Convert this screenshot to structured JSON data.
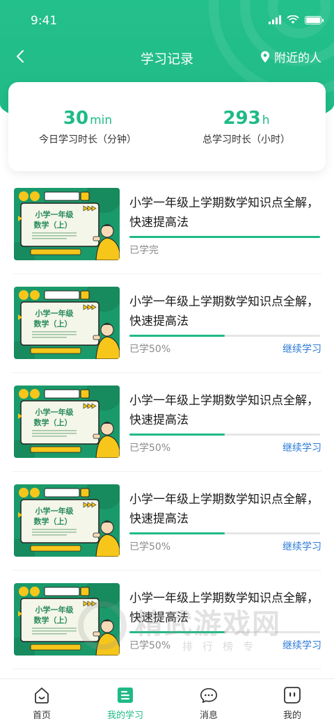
{
  "status_bar": {
    "time": "9:41"
  },
  "nav": {
    "title": "学习记录",
    "nearby_label": "附近的人"
  },
  "stats": {
    "today": {
      "value": "30",
      "unit": "min",
      "label": "今日学习时长（分钟）"
    },
    "total": {
      "value": "293",
      "unit": "h",
      "label": "总学习时长（小时）"
    }
  },
  "thumbnail": {
    "line1": "小学一年级",
    "line2": "数学（上）"
  },
  "courses": [
    {
      "title": "小学一年级上学期数学知识点全解，快速提高法",
      "progress_text": "已学完",
      "progress": 1.0,
      "action": ""
    },
    {
      "title": "小学一年级上学期数学知识点全解，快速提高法",
      "progress_text": "已学50%",
      "progress": 0.5,
      "action": "继续学习"
    },
    {
      "title": "小学一年级上学期数学知识点全解，快速提高法",
      "progress_text": "已学50%",
      "progress": 0.5,
      "action": "继续学习"
    },
    {
      "title": "小学一年级上学期数学知识点全解，快速提高法",
      "progress_text": "已学50%",
      "progress": 0.5,
      "action": "继续学习"
    },
    {
      "title": "小学一年级上学期数学知识点全解，快速提高法",
      "progress_text": "已学50%",
      "progress": 0.5,
      "action": "继续学习"
    }
  ],
  "watermark": {
    "text": "精武游戏网",
    "sub": "排行榜专"
  },
  "tabs": [
    {
      "label": "首页",
      "icon": "home-icon",
      "active": false
    },
    {
      "label": "我的学习",
      "icon": "study-icon",
      "active": true
    },
    {
      "label": "消息",
      "icon": "message-icon",
      "active": false
    },
    {
      "label": "我的",
      "icon": "profile-icon",
      "active": false
    }
  ],
  "colors": {
    "primary": "#1fba86",
    "link": "#2b7ad6",
    "thumb_green": "#1a9a6a",
    "thumb_yellow": "#f6c61b"
  }
}
